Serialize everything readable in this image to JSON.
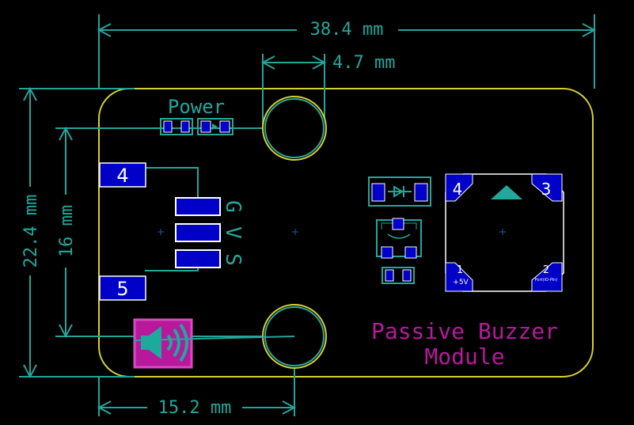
{
  "dimensions": {
    "width": "38.4 mm",
    "hole_diameter": "4.7 mm",
    "height": "22.4 mm",
    "pin_spacing": "16 mm",
    "hole_offset": "15.2 mm"
  },
  "labels": {
    "power": "Power",
    "module_line1": "Passive Buzzer",
    "module_line2": "Module",
    "gvs_g": "G",
    "gvs_v": "V",
    "gvs_s": "S"
  },
  "pads": {
    "left_top": "4",
    "left_bottom": "5",
    "buzzer_tl": "4",
    "buzzer_tr": "3",
    "buzzer_bl": "1",
    "buzzer_br": "2",
    "buzzer_bl_sub": "+5V",
    "buzzer_br_sub": "Port(IO-Pin)"
  },
  "colors": {
    "board_outline": "#d8d02c",
    "dimension": "#21a59a",
    "pad": "#0000c8",
    "silk_magenta": "#b8189c"
  }
}
